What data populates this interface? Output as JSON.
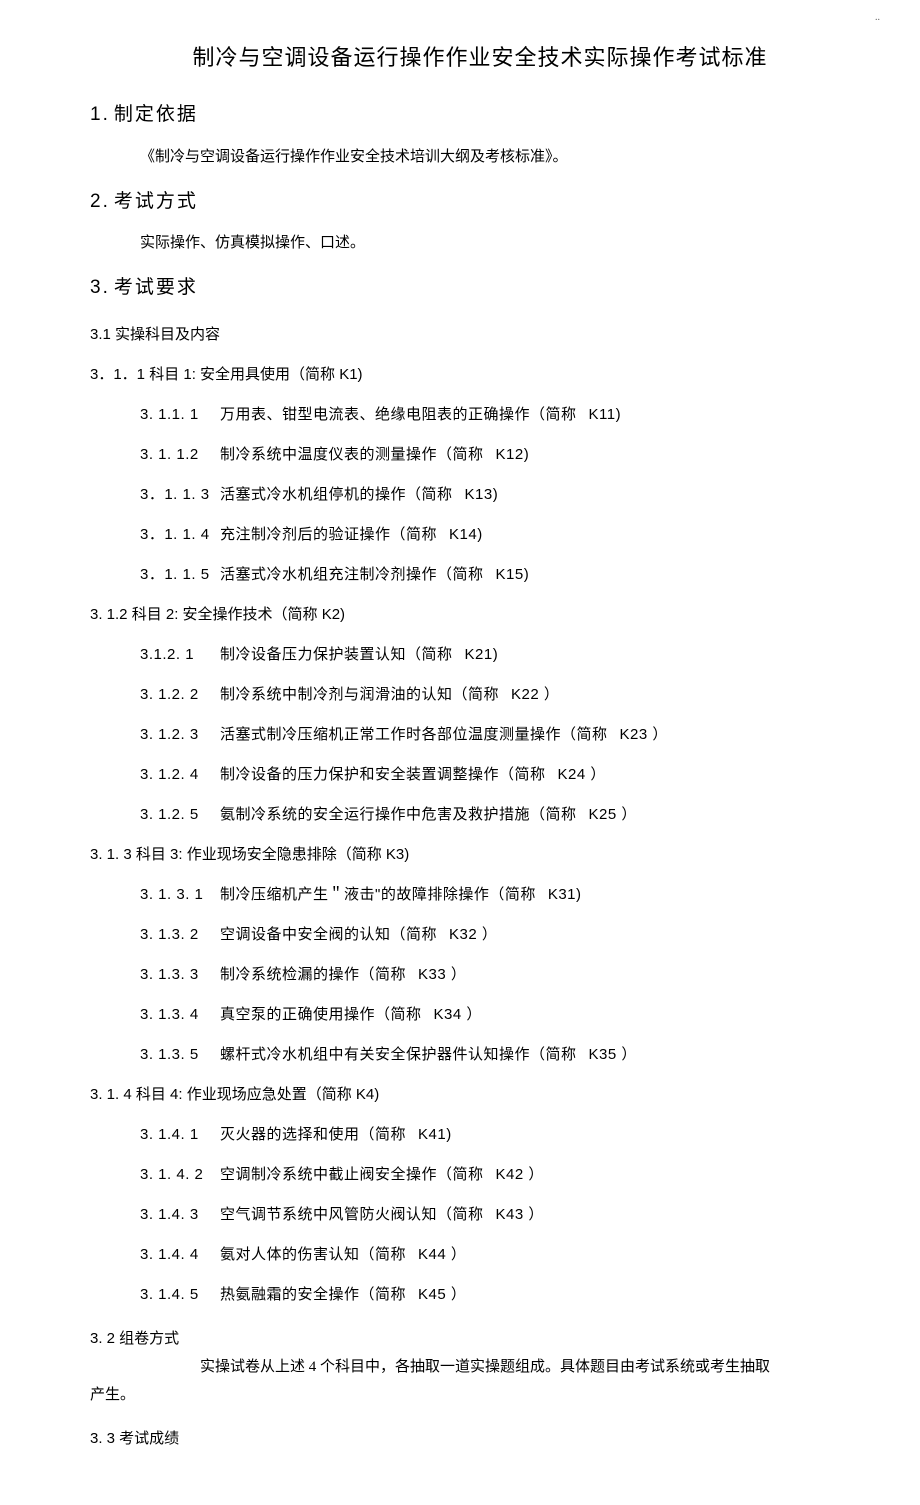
{
  "corner": "..",
  "title": "制冷与空调设备运行操作作业安全技术实际操作考试标准",
  "sections": {
    "s1_num": "1.",
    "s1_title": "制定依据",
    "s1_body": "《制冷与空调设备运行操作作业安全技术培训大纲及考核标准》。",
    "s2_num": "2.",
    "s2_title": "考试方式",
    "s2_body": "实际操作、仿真模拟操作、口述。",
    "s3_num": "3.",
    "s3_title": "考试要求",
    "s31": "3.1 实操科目及内容",
    "k1": "3．1．1  科目 1: 安全用具使用（简称   K1)",
    "k1_items": [
      {
        "num": "3. 1.1. 1",
        "text": "万用表、钳型电流表、绝缘电阻表的正确操作（简称",
        "code": "K11)"
      },
      {
        "num": "3. 1. 1.2",
        "text": "制冷系统中温度仪表的测量操作（简称",
        "code": "K12)"
      },
      {
        "num": "3．1. 1. 3",
        "text": "活塞式冷水机组停机的操作（简称",
        "code": "K13)"
      },
      {
        "num": "3．1. 1. 4",
        "text": "充注制冷剂后的验证操作（简称",
        "code": "K14)"
      },
      {
        "num": "3．1. 1. 5",
        "text": "活塞式冷水机组充注制冷剂操作（简称",
        "code": "K15)"
      }
    ],
    "k2": "3. 1.2   科目 2: 安全操作技术（简称   K2)",
    "k2_items": [
      {
        "num": "3.1.2. 1",
        "text": "制冷设备压力保护装置认知（简称",
        "code": "K21)"
      },
      {
        "num": "3. 1.2. 2",
        "text": "制冷系统中制冷剂与润滑油的认知（简称",
        "code": "K22 ）"
      },
      {
        "num": "3. 1.2. 3",
        "text": "活塞式制冷压缩机正常工作时各部位温度测量操作（简称",
        "code": "K23 ）"
      },
      {
        "num": "3. 1.2. 4",
        "text": "制冷设备的压力保护和安全装置调整操作（简称",
        "code": "K24 ）"
      },
      {
        "num": "3. 1.2. 5",
        "text": "氨制冷系统的安全运行操作中危害及救护措施（简称",
        "code": "K25 ）"
      }
    ],
    "k3": "3. 1. 3    科目 3: 作业现场安全隐患排除（简称    K3)",
    "k3_items": [
      {
        "num": "3. 1. 3. 1",
        "text": "制冷压缩机产生＂液击\"的故障排除操作（简称",
        "code": "K31)"
      },
      {
        "num": "3. 1.3. 2",
        "text": "空调设备中安全阀的认知（简称",
        "code": "K32 ）"
      },
      {
        "num": "3. 1.3. 3",
        "text": "制冷系统检漏的操作（简称",
        "code": "K33 ）"
      },
      {
        "num": "3. 1.3. 4",
        "text": "真空泵的正确使用操作（简称",
        "code": "K34 ）"
      },
      {
        "num": "3. 1.3. 5",
        "text": "螺杆式冷水机组中有关安全保护器件认知操作（简称",
        "code": "K35 ）"
      }
    ],
    "k4": "3. 1. 4    科目 4: 作业现场应急处置（简称    K4)",
    "k4_items": [
      {
        "num": "3. 1.4. 1",
        "text": "灭火器的选择和使用（简称",
        "code": "K41)"
      },
      {
        "num": "3. 1. 4. 2",
        "text": "空调制冷系统中截止阀安全操作（简称",
        "code": "K42 ）"
      },
      {
        "num": "3. 1.4. 3",
        "text": "空气调节系统中风管防火阀认知（简称",
        "code": "K43 ）"
      },
      {
        "num": "3. 1.4. 4",
        "text": "氨对人体的伤害认知（简称",
        "code": "K44 ）"
      },
      {
        "num": "3. 1.4. 5",
        "text": "热氨融霜的安全操作（简称",
        "code": "K45 ）"
      }
    ],
    "s32": "3. 2  组卷方式",
    "s32_body1": "实操试卷从上述   4 个科目中，各抽取一道实操题组成。具体题目由考试系统或考生抽取",
    "s32_body2": "产生。",
    "s33": "3. 3  考试成绩"
  }
}
